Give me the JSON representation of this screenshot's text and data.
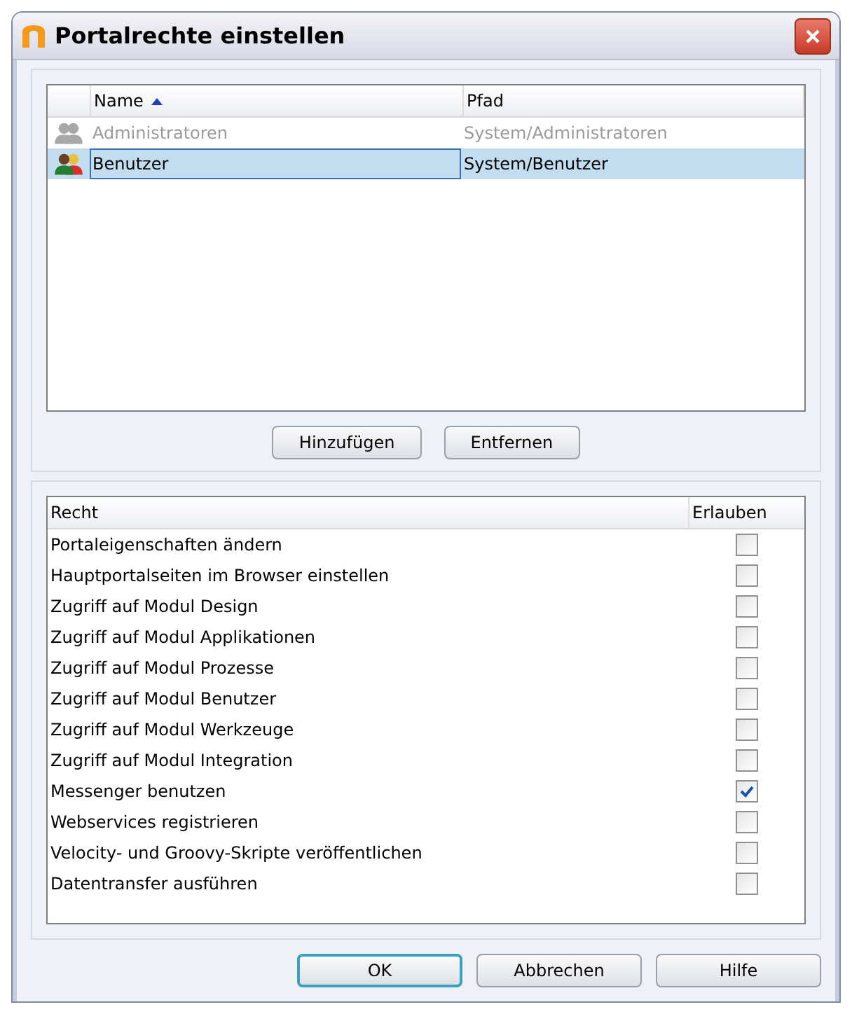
{
  "window": {
    "title": "Portalrechte einstellen"
  },
  "groups": {
    "columns": [
      {
        "label": "Name",
        "sorted": true
      },
      {
        "label": "Pfad",
        "sorted": false
      }
    ],
    "rows": [
      {
        "name": "Administratoren",
        "path": "System/Administratoren",
        "selected": false,
        "disabled": true
      },
      {
        "name": "Benutzer",
        "path": "System/Benutzer",
        "selected": true,
        "disabled": false
      }
    ],
    "buttons": [
      "Hinzufügen",
      "Entfernen"
    ]
  },
  "rights": {
    "columns": [
      "Recht",
      "Erlauben"
    ],
    "rows": [
      {
        "label": "Portaleigenschaften ändern",
        "checked": false
      },
      {
        "label": "Hauptportalseiten im Browser einstellen",
        "checked": false
      },
      {
        "label": "Zugriff auf Modul Design",
        "checked": false
      },
      {
        "label": "Zugriff auf Modul Applikationen",
        "checked": false
      },
      {
        "label": "Zugriff auf Modul Prozesse",
        "checked": false
      },
      {
        "label": "Zugriff auf Modul Benutzer",
        "checked": false
      },
      {
        "label": "Zugriff auf Modul Werkzeuge",
        "checked": false
      },
      {
        "label": "Zugriff auf Modul Integration",
        "checked": false
      },
      {
        "label": "Messenger benutzen",
        "checked": true
      },
      {
        "label": "Webservices registrieren",
        "checked": false
      },
      {
        "label": "Velocity- und Groovy-Skripte veröffentlichen",
        "checked": false
      },
      {
        "label": "Datentransfer ausführen",
        "checked": false
      }
    ]
  },
  "buttons": [
    {
      "label": "OK",
      "kind": "default"
    },
    {
      "label": "Abbrechen",
      "kind": "normal"
    },
    {
      "label": "Hilfe",
      "kind": "normal"
    }
  ]
}
